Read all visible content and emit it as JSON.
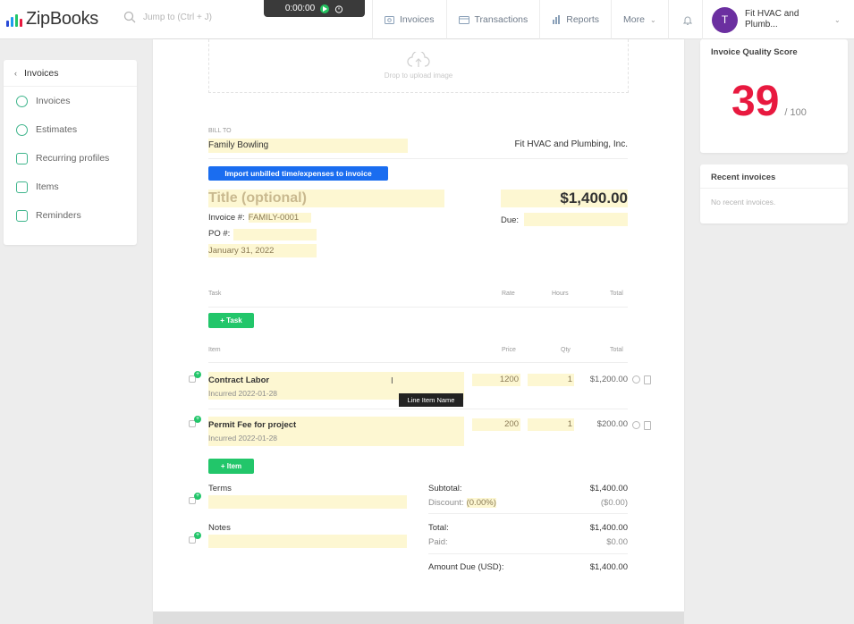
{
  "topbar": {
    "logo_text": "ZipBooks",
    "logo_bar_colors": [
      "#2a4bd7",
      "#1f9bf0",
      "#22c66a",
      "#e8193f"
    ],
    "search_placeholder": "Jump to (Ctrl + J)",
    "timer": "0:00:00",
    "nav": [
      {
        "label": "Invoices",
        "icon": "invoice-icon"
      },
      {
        "label": "Transactions",
        "icon": "transactions-icon"
      },
      {
        "label": "Reports",
        "icon": "reports-icon"
      },
      {
        "label": "More",
        "icon": "chevron-down-icon"
      }
    ],
    "account": {
      "initial": "T",
      "name": "Fit HVAC and Plumb..."
    }
  },
  "sidebar": {
    "back_label": "Invoices",
    "items": [
      {
        "label": "Invoices",
        "icon": "dollar-icon"
      },
      {
        "label": "Estimates",
        "icon": "estimate-icon"
      },
      {
        "label": "Recurring profiles",
        "icon": "recurring-icon"
      },
      {
        "label": "Items",
        "icon": "items-icon"
      },
      {
        "label": "Reminders",
        "icon": "reminder-icon"
      }
    ]
  },
  "invoice": {
    "dropzone_text": "Drop to upload image",
    "bill_to_label": "BILL TO",
    "bill_to": "Family Bowling",
    "company": "Fit HVAC and Plumbing, Inc.",
    "import_button": "Import unbilled time/expenses to invoice",
    "title_placeholder": "Title (optional)",
    "total": "$1,400.00",
    "invoice_number_label": "Invoice #:",
    "invoice_number": "FAMILY-0001",
    "po_label": "PO #:",
    "date": "January 31, 2022",
    "due_label": "Due:",
    "task_headers": {
      "task": "Task",
      "rate": "Rate",
      "hours": "Hours",
      "total": "Total"
    },
    "add_task": "+ Task",
    "item_headers": {
      "item": "Item",
      "price": "Price",
      "qty": "Qty",
      "total": "Total"
    },
    "items": [
      {
        "name": "Contract Labor",
        "incurred": "Incurred 2022-01-28",
        "price": "1200",
        "qty": "1",
        "total": "$1,200.00"
      },
      {
        "name": "Permit Fee for project",
        "incurred": "Incurred 2022-01-28",
        "price": "200",
        "qty": "1",
        "total": "$200.00"
      }
    ],
    "tooltip": "Line Item Name",
    "add_item": "+ Item",
    "terms_label": "Terms",
    "notes_label": "Notes",
    "summary": {
      "subtotal_label": "Subtotal:",
      "subtotal": "$1,400.00",
      "discount_label": "Discount:",
      "discount_pct": "(0.00%)",
      "discount": "($0.00)",
      "total_label": "Total:",
      "total": "$1,400.00",
      "paid_label": "Paid:",
      "paid": "$0.00",
      "amount_due_label": "Amount Due (USD):",
      "amount_due": "$1,400.00"
    }
  },
  "quality": {
    "title": "Invoice Quality Score",
    "score": "39",
    "out_of": "/ 100",
    "score_color": "#e8193f"
  },
  "recent": {
    "title": "Recent invoices",
    "empty": "No recent invoices."
  }
}
